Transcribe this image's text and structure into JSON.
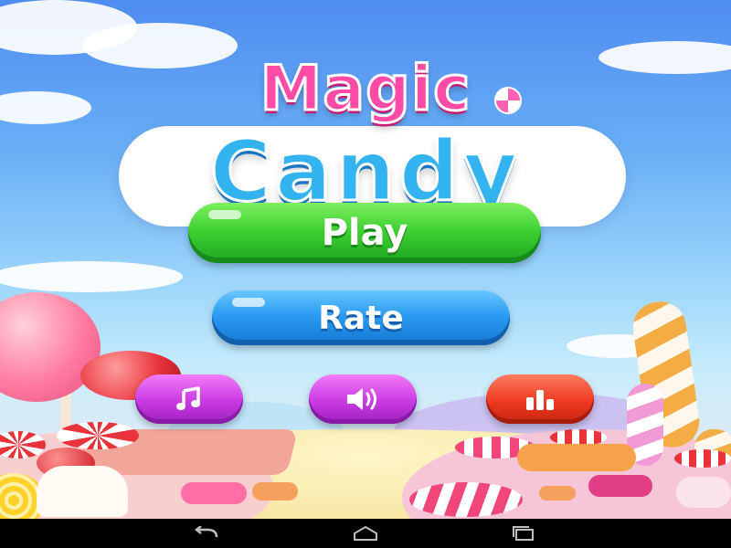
{
  "app": {
    "title_line1": "Magic",
    "title_line2": "Candy"
  },
  "menu": {
    "play_label": "Play",
    "rate_label": "Rate"
  },
  "icon_buttons": [
    {
      "name": "music",
      "icon": "music-note-icon"
    },
    {
      "name": "sound",
      "icon": "speaker-icon"
    },
    {
      "name": "ranking",
      "icon": "bar-chart-icon"
    }
  ],
  "navigation_bar": {
    "buttons": [
      {
        "name": "back",
        "icon": "back-arrow-icon"
      },
      {
        "name": "home",
        "icon": "home-icon"
      },
      {
        "name": "recent-apps",
        "icon": "recent-apps-icon"
      }
    ]
  },
  "colors": {
    "title_magic": "#ff4aa6",
    "title_candy": "#33b3f0",
    "play_button": "#3fd132",
    "rate_button": "#2a9cf1",
    "music_sound_buttons": "#c93ae2",
    "ranking_button": "#ee3a21"
  }
}
